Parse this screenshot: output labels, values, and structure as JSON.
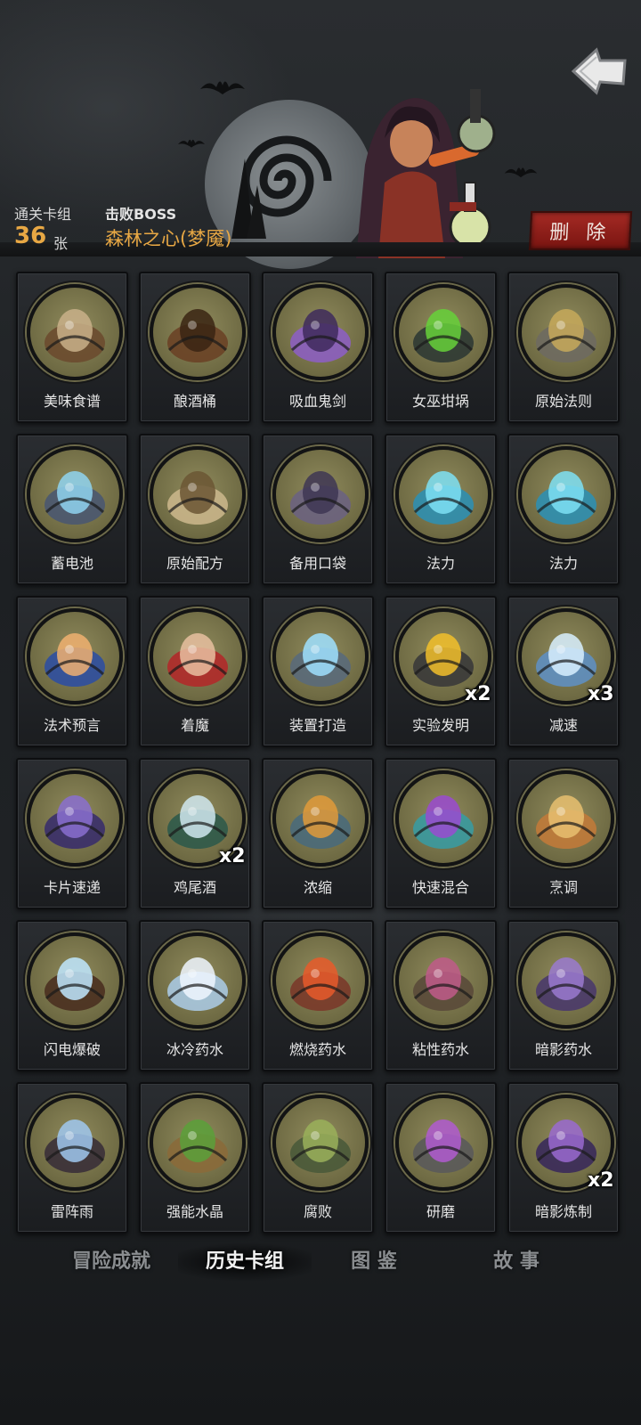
{
  "header": {
    "back_icon": "back-arrow-icon",
    "deck_label": "通关卡组",
    "deck_count": "36",
    "deck_unit": "张",
    "boss_label": "击败BOSS",
    "boss_name": "森林之心(梦魇)",
    "delete_label": "删 除"
  },
  "cards": [
    {
      "name": "美味食谱",
      "icon": "recipe-book-icon"
    },
    {
      "name": "酿酒桶",
      "icon": "barrel-icon"
    },
    {
      "name": "吸血鬼剑",
      "icon": "vampire-sword-icon"
    },
    {
      "name": "女巫坩埚",
      "icon": "witch-cauldron-icon"
    },
    {
      "name": "原始法则",
      "icon": "scales-icon"
    },
    {
      "name": "蓄电池",
      "icon": "battery-chest-icon"
    },
    {
      "name": "原始配方",
      "icon": "scroll-icon"
    },
    {
      "name": "备用口袋",
      "icon": "pouch-icon"
    },
    {
      "name": "法力",
      "icon": "mana-orb-icon"
    },
    {
      "name": "法力",
      "icon": "mana-orb-icon"
    },
    {
      "name": "法术预言",
      "icon": "crystal-ball-icon"
    },
    {
      "name": "着魔",
      "icon": "possessed-icon"
    },
    {
      "name": "装置打造",
      "icon": "device-icon"
    },
    {
      "name": "实验发明",
      "icon": "invention-icon",
      "mult": "x2"
    },
    {
      "name": "减速",
      "icon": "clock-icon",
      "mult": "x3"
    },
    {
      "name": "卡片速递",
      "icon": "card-delivery-icon"
    },
    {
      "name": "鸡尾酒",
      "icon": "cocktail-icon",
      "mult": "x2"
    },
    {
      "name": "浓缩",
      "icon": "distill-icon"
    },
    {
      "name": "快速混合",
      "icon": "quick-mix-icon"
    },
    {
      "name": "烹调",
      "icon": "cooking-icon"
    },
    {
      "name": "闪电爆破",
      "icon": "lightning-icon"
    },
    {
      "name": "冰冷药水",
      "icon": "ice-potion-icon"
    },
    {
      "name": "燃烧药水",
      "icon": "fire-potion-icon"
    },
    {
      "name": "粘性药水",
      "icon": "sticky-potion-icon"
    },
    {
      "name": "暗影药水",
      "icon": "shadow-potion-icon"
    },
    {
      "name": "雷阵雨",
      "icon": "thunderstorm-icon"
    },
    {
      "name": "强能水晶",
      "icon": "crystal-icon"
    },
    {
      "name": "腐败",
      "icon": "decay-icon"
    },
    {
      "name": "研磨",
      "icon": "grind-icon"
    },
    {
      "name": "暗影炼制",
      "icon": "shadow-brew-icon",
      "mult": "x2"
    }
  ],
  "tabs": [
    {
      "label": "冒险成就",
      "active": false
    },
    {
      "label": "历史卡组",
      "active": true
    },
    {
      "label": "图 鉴",
      "active": false
    },
    {
      "label": "故 事",
      "active": false
    }
  ],
  "colors": {
    "accent": "#e8a844",
    "delete": "#a42a24",
    "medal": "#7d784e"
  }
}
